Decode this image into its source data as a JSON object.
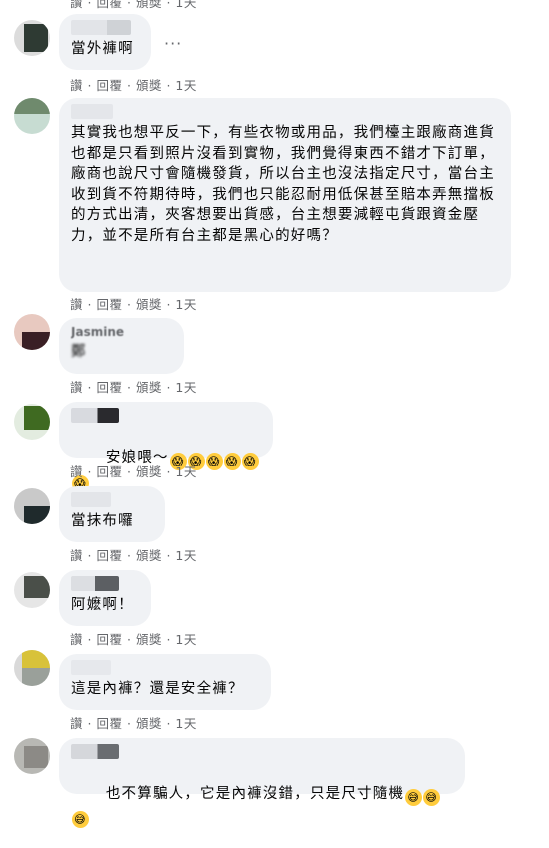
{
  "actions": {
    "like": "讚",
    "reply": "回覆",
    "award": "頒獎",
    "time": "1天",
    "sep": "·"
  },
  "more_menu": "···",
  "comments": [
    {
      "text": "當外褲啊"
    },
    {
      "text": "其實我也想平反一下，有些衣物或用品，我們檯主跟廠商進貨也都是只看到照片沒看到實物，我們覺得東西不錯才下訂單，廠商也說尺寸會隨機發貨，所以台主也沒法指定尺寸，當台主收到貨不符期待時，我們也只能忍耐用低保甚至賠本弄無擋板的方式出清，夾客想要出貨感，台主想要減輕屯貨跟資金壓力，並不是所有台主都是黑心的好嗎？"
    },
    {
      "name": "Jasmine",
      "text": "鄭"
    },
    {
      "text": "安娘喂～",
      "emoji": [
        "😱",
        "😱",
        "😱",
        "😱",
        "😱",
        "😱"
      ]
    },
    {
      "text": "當抹布囉"
    },
    {
      "text": "阿嬷啊！"
    },
    {
      "text": "這是內褲？還是安全褲？"
    },
    {
      "text": "也不算騙人，它是內褲沒錯，只是尺寸隨機",
      "emoji": [
        "😅",
        "😅",
        "😅"
      ]
    }
  ]
}
